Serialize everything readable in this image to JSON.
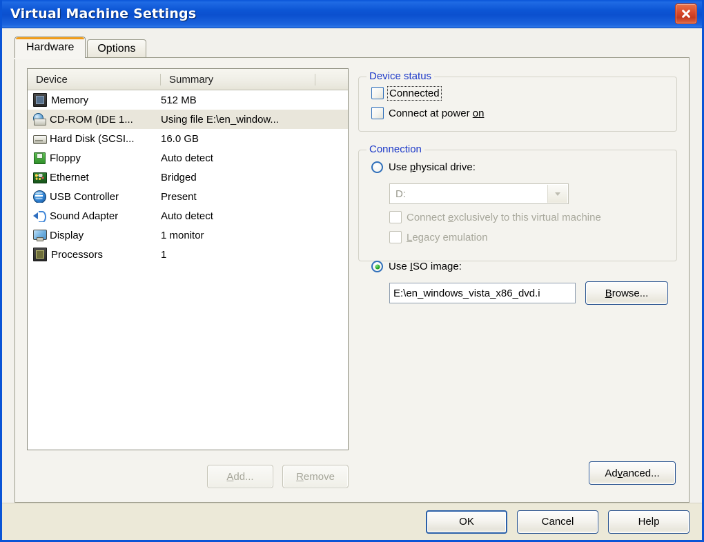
{
  "window": {
    "title": "Virtual Machine Settings",
    "close_icon": "close-icon"
  },
  "tabs": [
    {
      "label": "Hardware",
      "active": true
    },
    {
      "label": "Options",
      "active": false
    }
  ],
  "device_list": {
    "columns": [
      "Device",
      "Summary"
    ],
    "rows": [
      {
        "icon": "memory-icon",
        "device": "Memory",
        "summary": "512 MB",
        "selected": false
      },
      {
        "icon": "cdrom-icon",
        "device": "CD-ROM (IDE 1...",
        "summary": "Using file E:\\en_window...",
        "selected": true
      },
      {
        "icon": "harddisk-icon",
        "device": "Hard Disk (SCSI...",
        "summary": "16.0 GB",
        "selected": false
      },
      {
        "icon": "floppy-icon",
        "device": "Floppy",
        "summary": "Auto detect",
        "selected": false
      },
      {
        "icon": "ethernet-icon",
        "device": "Ethernet",
        "summary": "Bridged",
        "selected": false
      },
      {
        "icon": "usb-icon",
        "device": "USB Controller",
        "summary": "Present",
        "selected": false
      },
      {
        "icon": "sound-icon",
        "device": "Sound Adapter",
        "summary": "Auto detect",
        "selected": false
      },
      {
        "icon": "display-icon",
        "device": "Display",
        "summary": "1 monitor",
        "selected": false
      },
      {
        "icon": "processors-icon",
        "device": "Processors",
        "summary": "1",
        "selected": false
      }
    ]
  },
  "list_buttons": {
    "add": {
      "label": "Add...",
      "accel": "A",
      "disabled": true
    },
    "remove": {
      "label": "Remove",
      "accel": "R",
      "disabled": true
    }
  },
  "device_status": {
    "legend": "Device status",
    "connected": {
      "label": "Connected",
      "checked": false,
      "focused": true
    },
    "connect_at_power_on": {
      "label": "Connect at power on",
      "accel": "on",
      "checked": false
    }
  },
  "connection": {
    "legend": "Connection",
    "use_physical_drive": {
      "label": "Use physical drive:",
      "accel": "p",
      "selected": false
    },
    "drive_combo": {
      "value": "D:",
      "disabled": true
    },
    "connect_exclusively": {
      "label": "Connect exclusively to this virtual machine",
      "accel": "e",
      "checked": false,
      "disabled": true
    },
    "legacy_emulation": {
      "label": "Legacy emulation",
      "accel": "L",
      "checked": false,
      "disabled": true
    },
    "use_iso_image": {
      "label": "Use ISO image:",
      "accel": "I",
      "selected": true
    },
    "iso_path": {
      "value": "E:\\en_windows_vista_x86_dvd.i"
    },
    "browse": {
      "label": "Browse...",
      "accel": "B"
    }
  },
  "advanced_button": {
    "label": "Advanced...",
    "accel": "v"
  },
  "dialog_buttons": {
    "ok": {
      "label": "OK",
      "default": true
    },
    "cancel": {
      "label": "Cancel"
    },
    "help": {
      "label": "Help"
    }
  },
  "colors": {
    "titlebar_blue": "#0c55d4",
    "window_border": "#0a54d6",
    "dialog_bg": "#f2f1ec",
    "bottom_bar": "#ece9d8",
    "group_legend": "#1c39c8",
    "selection": "#e9e6db",
    "close_button": "#d7482a",
    "tab_highlight": "#f6a623"
  }
}
